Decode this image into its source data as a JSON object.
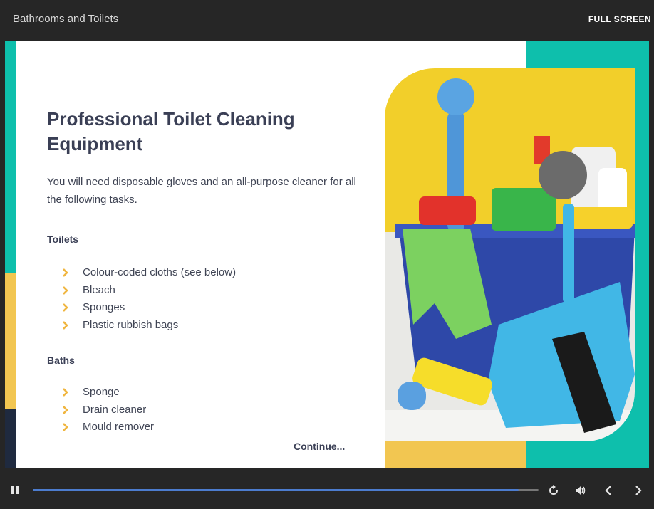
{
  "header": {
    "course_title": "Bathrooms and Toilets",
    "fullscreen_label": "FULL SCREEN"
  },
  "slide": {
    "title": "Professional Toilet Cleaning Equipment",
    "intro": "You will need disposable gloves and an all-purpose cleaner for all the following tasks.",
    "sections": [
      {
        "heading": "Toilets",
        "items": [
          "Colour-coded cloths (see below)",
          "Bleach",
          "Sponges",
          "Plastic rubbish bags"
        ]
      },
      {
        "heading": "Baths",
        "items": [
          "Sponge",
          "Drain cleaner",
          "Mould remover"
        ]
      }
    ],
    "continue_label": "Continue..."
  },
  "player": {
    "progress": 0.96
  },
  "icons": {
    "pause": "pause-icon",
    "replay": "replay-icon",
    "volume": "volume-icon",
    "prev": "chevron-left-icon",
    "next": "chevron-right-icon",
    "bullet": "chevron-right-icon"
  },
  "colors": {
    "teal": "#0ebfac",
    "yellow": "#f2c651",
    "navy": "#1f2a3f",
    "bullet": "#f0b640",
    "progress": "#4c7ccf"
  }
}
